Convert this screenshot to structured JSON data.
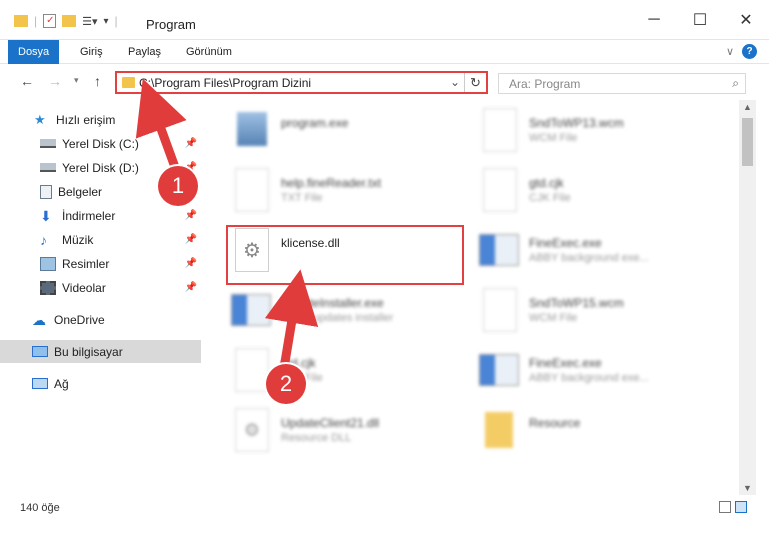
{
  "window": {
    "title": "Program"
  },
  "ribbon": {
    "tabs": [
      "Dosya",
      "Giriş",
      "Paylaş",
      "Görünüm"
    ]
  },
  "address": {
    "path": "C:\\Program Files\\Program Dizini"
  },
  "search": {
    "placeholder": "Ara: Program"
  },
  "sidebar": {
    "items": [
      {
        "label": "Hızlı erişim"
      },
      {
        "label": "Yerel Disk (C:)"
      },
      {
        "label": "Yerel Disk (D:)"
      },
      {
        "label": "Belgeler"
      },
      {
        "label": "İndirmeler"
      },
      {
        "label": "Müzik"
      },
      {
        "label": "Resimler"
      },
      {
        "label": "Videolar"
      },
      {
        "label": "OneDrive"
      },
      {
        "label": "Bu bilgisayar"
      },
      {
        "label": "Ağ"
      }
    ]
  },
  "files": [
    {
      "name": "program.exe",
      "sub": ""
    },
    {
      "name": "SndToWP13.wcm",
      "sub": "WCM File"
    },
    {
      "name": "help.fineReader.txt",
      "sub": "TXT File"
    },
    {
      "name": "gtd.cjk",
      "sub": "CJK File"
    },
    {
      "name": "klicense.dll",
      "sub": ""
    },
    {
      "name": "FineExec.exe",
      "sub": "ABBY background exe..."
    },
    {
      "name": "UpdateInstaller.exe",
      "sub": "ABBY updates installer"
    },
    {
      "name": "SndToWP15.wcm",
      "sub": "WCM File"
    },
    {
      "name": "gtd.cjk",
      "sub": "CJK File"
    },
    {
      "name": "FineExec.exe",
      "sub": "ABBY background exe..."
    },
    {
      "name": "UpdateClient21.dll",
      "sub": "Resource DLL"
    },
    {
      "name": "Resource",
      "sub": ""
    }
  ],
  "status": {
    "count": "140 öğe"
  },
  "annotations": {
    "step1": "1",
    "step2": "2"
  },
  "colors": {
    "accent": "#1a73c9",
    "highlight": "#e34040",
    "folder": "#f2c44b"
  }
}
